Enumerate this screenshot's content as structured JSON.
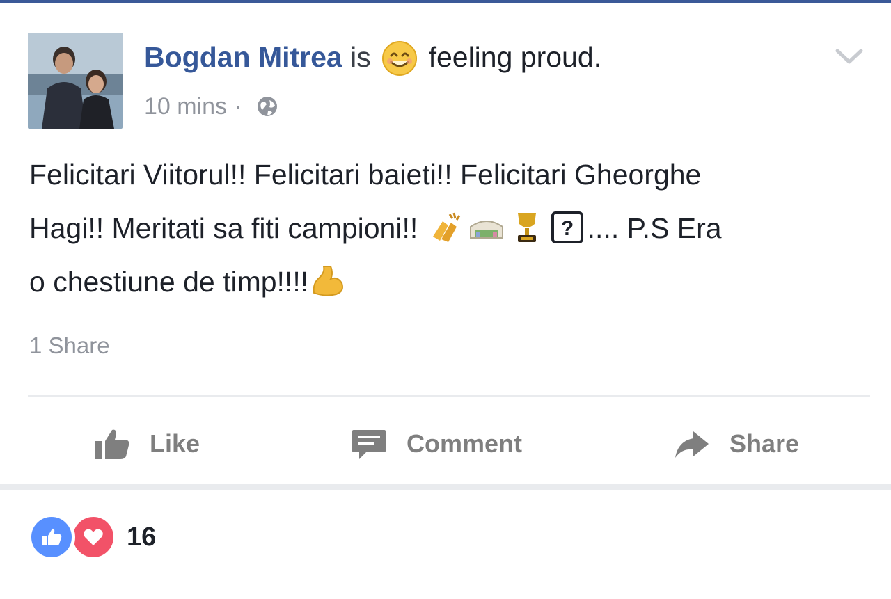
{
  "post": {
    "author": "Bogdan Mitrea",
    "connector": "is",
    "feeling": "feeling proud.",
    "timestamp": "10 mins",
    "separator": "·",
    "privacy_icon": "globe-icon",
    "text_line1": "Felicitari Viitorul!! Felicitari baieti!! Felicitari Gheorghe",
    "text_line2_a": "Hagi!! Meritati sa fiti campioni!!",
    "text_line2_b": ".... P.S Era",
    "text_line3": "o chestiune de timp!!!!",
    "emojis": [
      "clapping-hands-icon",
      "stadium-icon",
      "trophy-icon",
      "unknown-char-icon",
      "flexed-biceps-icon"
    ],
    "shares": "1 Share"
  },
  "actions": {
    "like": "Like",
    "comment": "Comment",
    "share": "Share"
  },
  "reactions": {
    "count": "16",
    "types": [
      "like-reaction-icon",
      "love-reaction-icon"
    ]
  },
  "colors": {
    "brand": "#3b5998",
    "author": "#365899",
    "meta": "#90949c",
    "like": "#5890ff",
    "love": "#f25268"
  }
}
